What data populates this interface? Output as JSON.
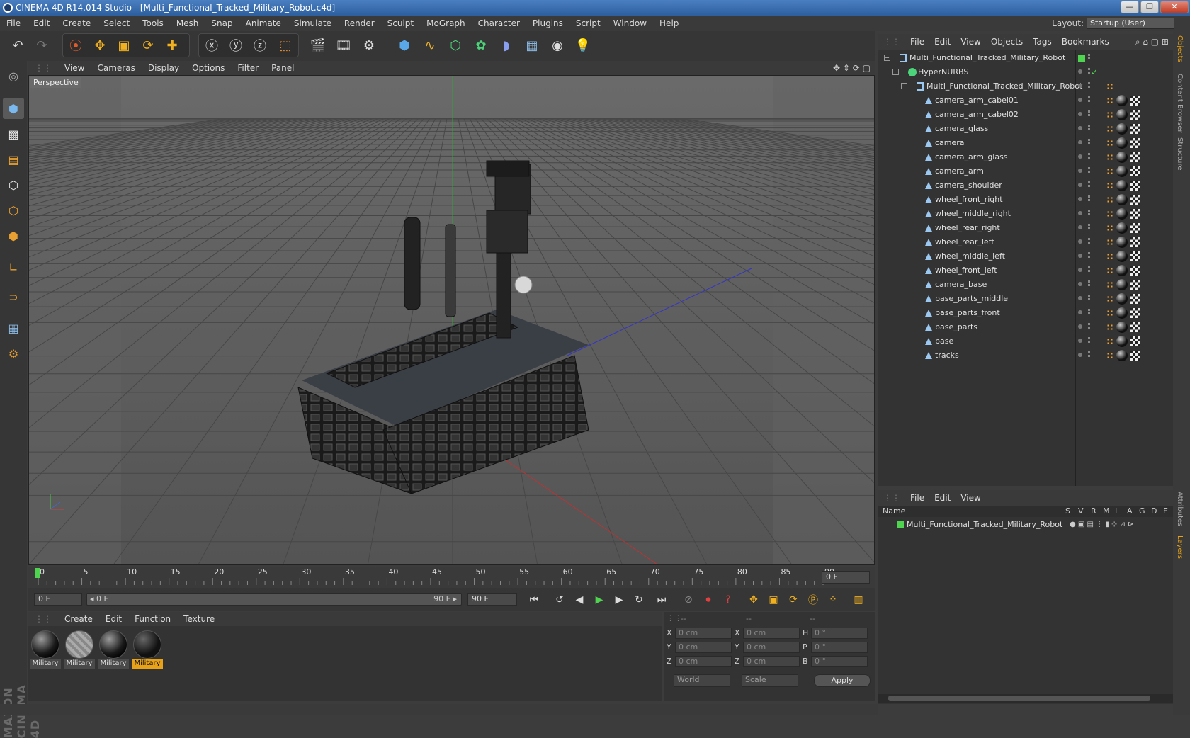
{
  "window": {
    "title": "CINEMA 4D R14.014 Studio - [Multi_Functional_Tracked_Military_Robot.c4d]",
    "minimize": "—",
    "maximize": "❐",
    "close": "✕"
  },
  "menu": {
    "items": [
      "File",
      "Edit",
      "Create",
      "Select",
      "Tools",
      "Mesh",
      "Snap",
      "Animate",
      "Simulate",
      "Render",
      "Sculpt",
      "MoGraph",
      "Character",
      "Plugins",
      "Script",
      "Window",
      "Help"
    ],
    "layout_label": "Layout:",
    "layout_value": "Startup (User)"
  },
  "viewport": {
    "menu": [
      "View",
      "Cameras",
      "Display",
      "Options",
      "Filter",
      "Panel"
    ],
    "label": "Perspective"
  },
  "timeline": {
    "ticks": [
      "0",
      "5",
      "10",
      "15",
      "20",
      "25",
      "30",
      "35",
      "40",
      "45",
      "50",
      "55",
      "60",
      "65",
      "70",
      "75",
      "80",
      "85",
      "90"
    ],
    "current_frame": "0 F",
    "start_field": "0 F",
    "range_start": "◂ 0 F",
    "range_end": "90 F ▸",
    "end_field": "90 F"
  },
  "materials": {
    "menu": [
      "Create",
      "Edit",
      "Function",
      "Texture"
    ],
    "items": [
      {
        "label": "Military",
        "selected": false
      },
      {
        "label": "Military",
        "selected": false
      },
      {
        "label": "Military",
        "selected": false
      },
      {
        "label": "Military",
        "selected": true
      }
    ]
  },
  "coords": {
    "headers": [
      "--",
      "--",
      "--"
    ],
    "rows": [
      {
        "a": "X",
        "av": "0 cm",
        "b": "X",
        "bv": "0 cm",
        "c": "H",
        "cv": "0 °"
      },
      {
        "a": "Y",
        "av": "0 cm",
        "b": "Y",
        "bv": "0 cm",
        "c": "P",
        "cv": "0 °"
      },
      {
        "a": "Z",
        "av": "0 cm",
        "b": "Z",
        "bv": "0 cm",
        "c": "B",
        "cv": "0 °"
      }
    ],
    "world": "World",
    "scale": "Scale",
    "apply": "Apply"
  },
  "objects": {
    "menu": [
      "File",
      "Edit",
      "View",
      "Objects",
      "Tags",
      "Bookmarks"
    ],
    "tree": [
      {
        "name": "Multi_Functional_Tracked_Military_Robot",
        "depth": 0,
        "kind": "null"
      },
      {
        "name": "HyperNURBS",
        "depth": 1,
        "kind": "nurbs"
      },
      {
        "name": "Multi_Functional_Tracked_Military_Robot",
        "depth": 2,
        "kind": "null"
      },
      {
        "name": "camera_arm_cabel01",
        "depth": 3,
        "kind": "poly"
      },
      {
        "name": "camera_arm_cabel02",
        "depth": 3,
        "kind": "poly"
      },
      {
        "name": "camera_glass",
        "depth": 3,
        "kind": "poly"
      },
      {
        "name": "camera",
        "depth": 3,
        "kind": "poly"
      },
      {
        "name": "camera_arm_glass",
        "depth": 3,
        "kind": "poly"
      },
      {
        "name": "camera_arm",
        "depth": 3,
        "kind": "poly"
      },
      {
        "name": "camera_shoulder",
        "depth": 3,
        "kind": "poly"
      },
      {
        "name": "wheel_front_right",
        "depth": 3,
        "kind": "poly"
      },
      {
        "name": "wheel_middle_right",
        "depth": 3,
        "kind": "poly"
      },
      {
        "name": "wheel_rear_right",
        "depth": 3,
        "kind": "poly"
      },
      {
        "name": "wheel_rear_left",
        "depth": 3,
        "kind": "poly"
      },
      {
        "name": "wheel_middle_left",
        "depth": 3,
        "kind": "poly"
      },
      {
        "name": "wheel_front_left",
        "depth": 3,
        "kind": "poly"
      },
      {
        "name": "camera_base",
        "depth": 3,
        "kind": "poly"
      },
      {
        "name": "base_parts_middle",
        "depth": 3,
        "kind": "poly"
      },
      {
        "name": "base_parts_front",
        "depth": 3,
        "kind": "poly"
      },
      {
        "name": "base_parts",
        "depth": 3,
        "kind": "poly"
      },
      {
        "name": "base",
        "depth": 3,
        "kind": "poly"
      },
      {
        "name": "tracks",
        "depth": 3,
        "kind": "poly"
      }
    ]
  },
  "layers": {
    "menu": [
      "File",
      "Edit",
      "View"
    ],
    "columns": [
      "Name",
      "S",
      "V",
      "R",
      "M",
      "L",
      "A",
      "G",
      "D",
      "E"
    ],
    "rows": [
      {
        "name": "Multi_Functional_Tracked_Military_Robot"
      }
    ]
  },
  "side_tabs": [
    "Objects",
    "Content Browser",
    "Structure",
    "Attributes",
    "Layers"
  ],
  "colors": {
    "accent": "#e8a217",
    "layer_green": "#4fd44f",
    "axis_green": "#2ea82e",
    "axis_red": "#b33",
    "axis_blue": "#33c"
  }
}
